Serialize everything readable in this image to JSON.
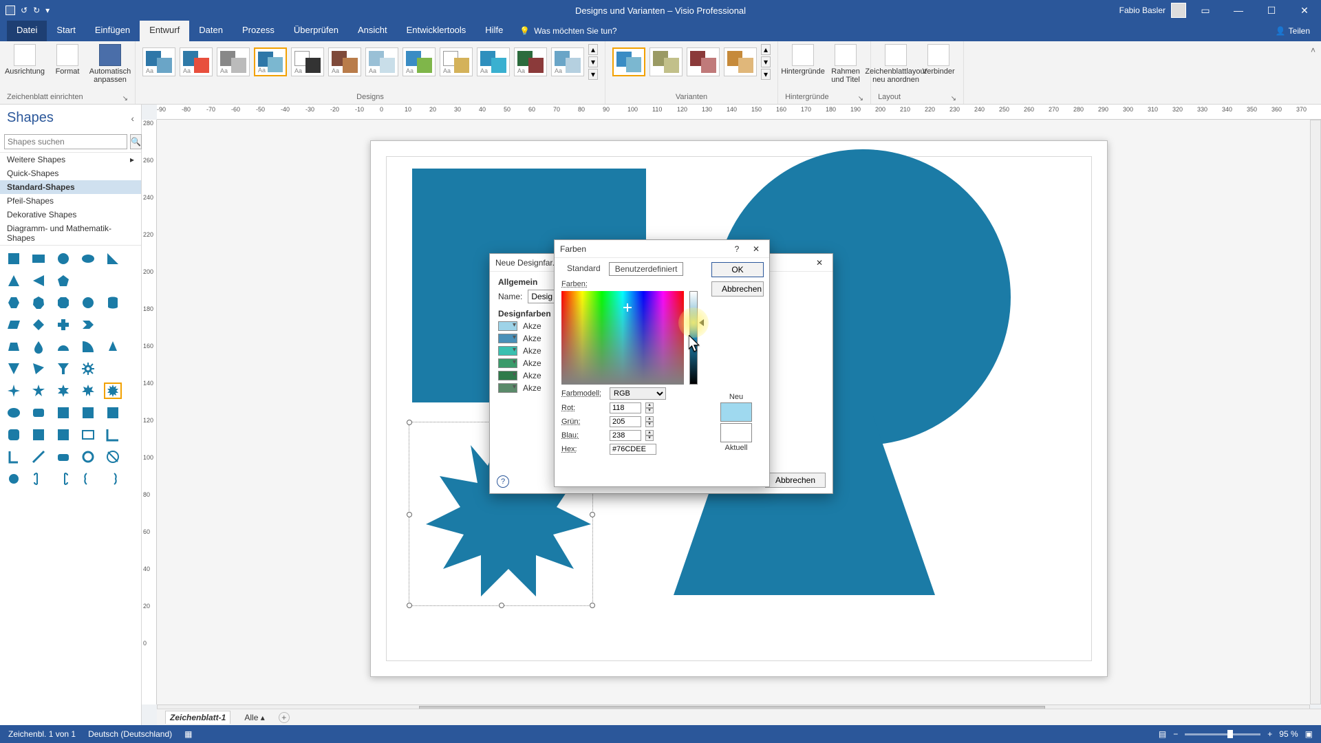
{
  "app": {
    "title": "Designs und Varianten – Visio Professional",
    "user": "Fabio Basler",
    "share": "Teilen"
  },
  "qat": {
    "undo_title": "Rückgängig",
    "redo_title": "Wiederholen",
    "save_title": "Speichern"
  },
  "tabs": {
    "file": "Datei",
    "start": "Start",
    "einfuegen": "Einfügen",
    "entwurf": "Entwurf",
    "daten": "Daten",
    "prozess": "Prozess",
    "ueberpruefen": "Überprüfen",
    "ansicht": "Ansicht",
    "entwickler": "Entwicklertools",
    "hilfe": "Hilfe",
    "tellme_placeholder": "Was möchten Sie tun?"
  },
  "ribbon": {
    "group_page": "Zeichenblatt einrichten",
    "btn_ausrichtung": "Ausrichtung",
    "btn_format": "Format",
    "btn_auto": "Automatisch anpassen",
    "group_designs": "Designs",
    "group_varianten": "Varianten",
    "group_hinter": "Hintergründe",
    "btn_hinter": "Hintergründe",
    "btn_rahmen": "Rahmen und Titel",
    "group_layout": "Layout",
    "btn_layout": "Zeichenblattlayout neu anordnen",
    "btn_verbinder": "Verbinder"
  },
  "shapes": {
    "title": "Shapes",
    "search_placeholder": "Shapes suchen",
    "cats": {
      "weitere": "Weitere Shapes",
      "quick": "Quick-Shapes",
      "standard": "Standard-Shapes",
      "pfeil": "Pfeil-Shapes",
      "dekorativ": "Dekorative Shapes",
      "diagramm": "Diagramm- und Mathematik-Shapes"
    }
  },
  "sheettabs": {
    "tab1": "Zeichenblatt-1",
    "all": "Alle"
  },
  "status": {
    "page": "Zeichenbl. 1 von 1",
    "lang": "Deutsch (Deutschland)",
    "zoom": "95 %"
  },
  "dlg_design": {
    "title": "Neue Designfar...",
    "allgemein": "Allgemein",
    "name_lbl": "Name:",
    "name_val": "Desig",
    "designfarben": "Designfarben",
    "akzent": "Akze",
    "abbrechen": "Abbrechen"
  },
  "dlg_color": {
    "title": "Farben",
    "tab_std": "Standard",
    "tab_custom": "Benutzerdefiniert",
    "ok": "OK",
    "abbrechen": "Abbrechen",
    "farben": "Farben:",
    "farbmodell": "Farbmodell:",
    "model": "RGB",
    "rot": "Rot:",
    "gruen": "Grün:",
    "blau": "Blau:",
    "hex": "Hex:",
    "r": "118",
    "g": "205",
    "b": "238",
    "hexv": "#76CDEE",
    "neu": "Neu",
    "aktuell": "Aktuell",
    "swatch_new": "#9fd9ef",
    "swatch_cur": "#ffffff"
  },
  "ruler_h": [
    "-90",
    "-80",
    "-70",
    "-60",
    "-50",
    "-40",
    "-30",
    "-20",
    "-10",
    "0",
    "10",
    "20",
    "30",
    "40",
    "50",
    "60",
    "70",
    "80",
    "90",
    "100",
    "110",
    "120",
    "130",
    "140",
    "150",
    "160",
    "170",
    "180",
    "190",
    "200",
    "210",
    "220",
    "230",
    "240",
    "250",
    "260",
    "270",
    "280",
    "290",
    "300",
    "310",
    "320",
    "330",
    "340",
    "350",
    "360",
    "370"
  ],
  "ruler_v": [
    "280",
    "260",
    "240",
    "220",
    "200",
    "180",
    "160",
    "140",
    "120",
    "100",
    "80",
    "60",
    "40",
    "20",
    "0"
  ]
}
